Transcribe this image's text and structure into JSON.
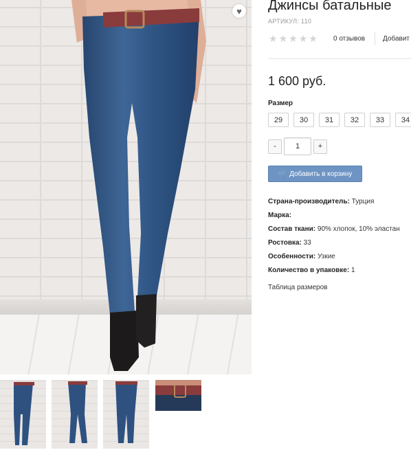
{
  "product": {
    "title": "Джинсы батальные",
    "sku": "АРТИКУЛ: 110",
    "rating": 0,
    "reviews": "0 отзывов",
    "add_review": "Добавит",
    "price": "1 600 руб."
  },
  "sizes": {
    "label": "Размер",
    "items": [
      "29",
      "30",
      "31",
      "32",
      "33",
      "34"
    ]
  },
  "quantity": {
    "minus": "-",
    "value": "1",
    "plus": "+"
  },
  "cart_button": {
    "label": "Добавить в корзину",
    "icon": "cart-icon"
  },
  "specs": [
    {
      "key": "Страна-производитель:",
      "value": " Турция"
    },
    {
      "key": "Марка:",
      "value": ""
    },
    {
      "key": "Состав ткани:",
      "value": " 90% хлопок, 10% эластан"
    },
    {
      "key": "Ростовка:",
      "value": " 33"
    },
    {
      "key": "Особенности:",
      "value": " Узкие"
    },
    {
      "key": "Количество в упаковке:",
      "value": " 1"
    }
  ],
  "size_table_link": "Таблица размеров",
  "colors": {
    "button": "#6e94c4",
    "denim": "#2e4f78",
    "belt": "#8a3b3c"
  }
}
